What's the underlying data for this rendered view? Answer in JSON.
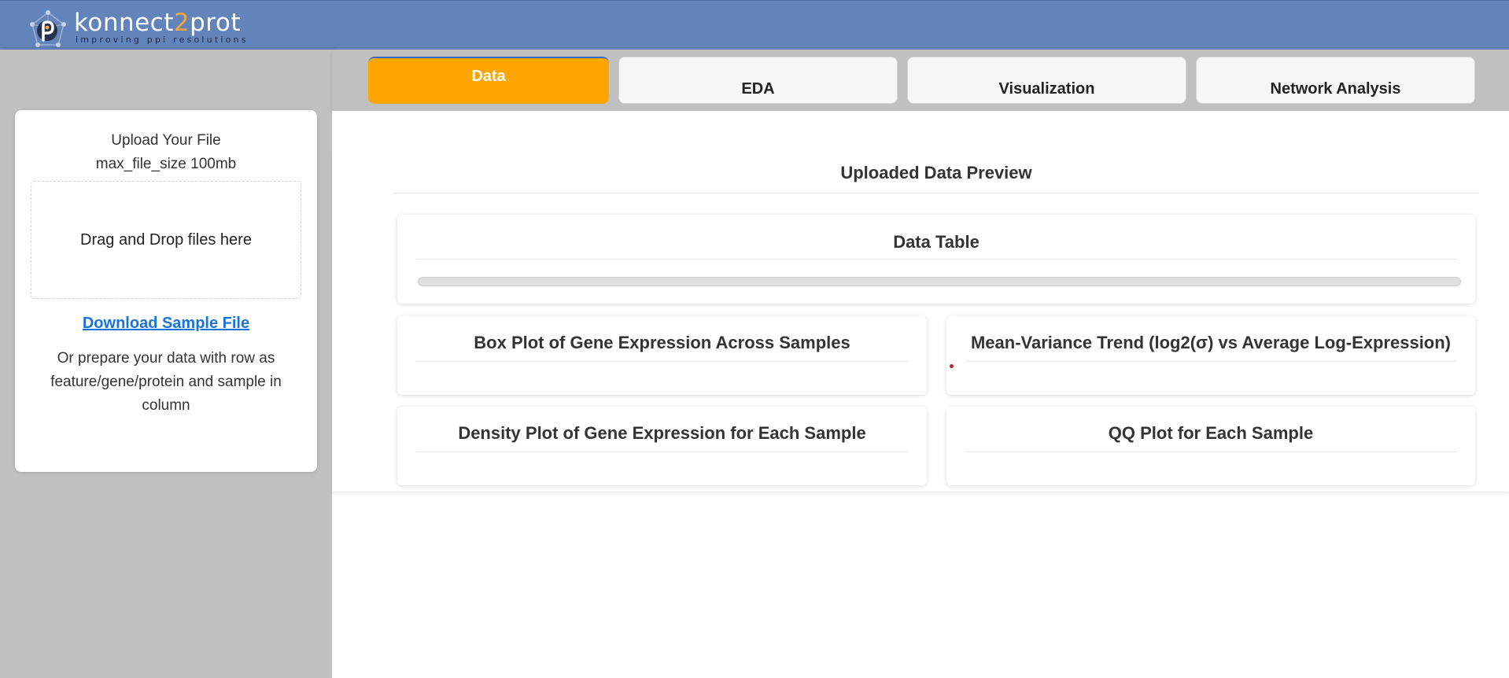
{
  "header": {
    "logo_title_pre": "konnect",
    "logo_title_accent": "2",
    "logo_title_post": "prot",
    "logo_subtitle": "improving ppi resolutions",
    "background_color": "#6383bb"
  },
  "sidebar": {
    "upload_title": "Upload Your File",
    "upload_size": "max_file_size 100mb",
    "dropzone_text": "Drag and Drop files here",
    "download_link": "Download Sample File",
    "note": "Or prepare your data with row as feature/gene/protein and sample in column"
  },
  "tabs": [
    {
      "label": "Data",
      "active": true
    },
    {
      "label": "EDA",
      "active": false
    },
    {
      "label": "Visualization",
      "active": false
    },
    {
      "label": "Network Analysis",
      "active": false
    }
  ],
  "main": {
    "preview_title": "Uploaded Data Preview",
    "data_table": {
      "title": "Data Table",
      "progress": 0
    },
    "plots": [
      {
        "title": "Box Plot of Gene Expression Across Samples"
      },
      {
        "title": "Mean-Variance Trend (log2(σ) vs Average Log-Expression)"
      },
      {
        "title": "Density Plot of Gene Expression for Each Sample"
      },
      {
        "title": "QQ Plot for Each Sample"
      }
    ]
  },
  "colors": {
    "active_tab": "#ffa500",
    "link": "#1a73d9",
    "sidebar": "#c0c0c0"
  }
}
